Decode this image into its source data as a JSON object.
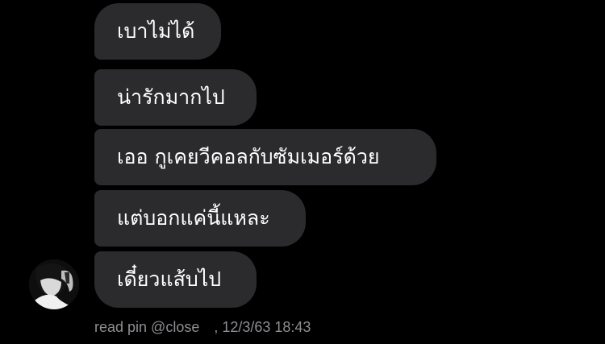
{
  "messages": [
    {
      "text": "เบาไม่ได้"
    },
    {
      "text": "น่ารักมากไป"
    },
    {
      "text": "เออ กูเคยวีคอลกับซัมเมอร์ด้วย"
    },
    {
      "text": "แต่บอกแค่นี้แหละ"
    },
    {
      "text": "เดี๋ยวแส้บไป"
    }
  ],
  "footer": {
    "read_text": "read pin @close",
    "timestamp": ", 12/3/63 18:43"
  },
  "colors": {
    "background": "#000000",
    "bubble": "#2b2b2e",
    "text": "#ffffff",
    "meta_text": "#8e8e93"
  },
  "icons": {
    "avatar": "profile-photo"
  }
}
